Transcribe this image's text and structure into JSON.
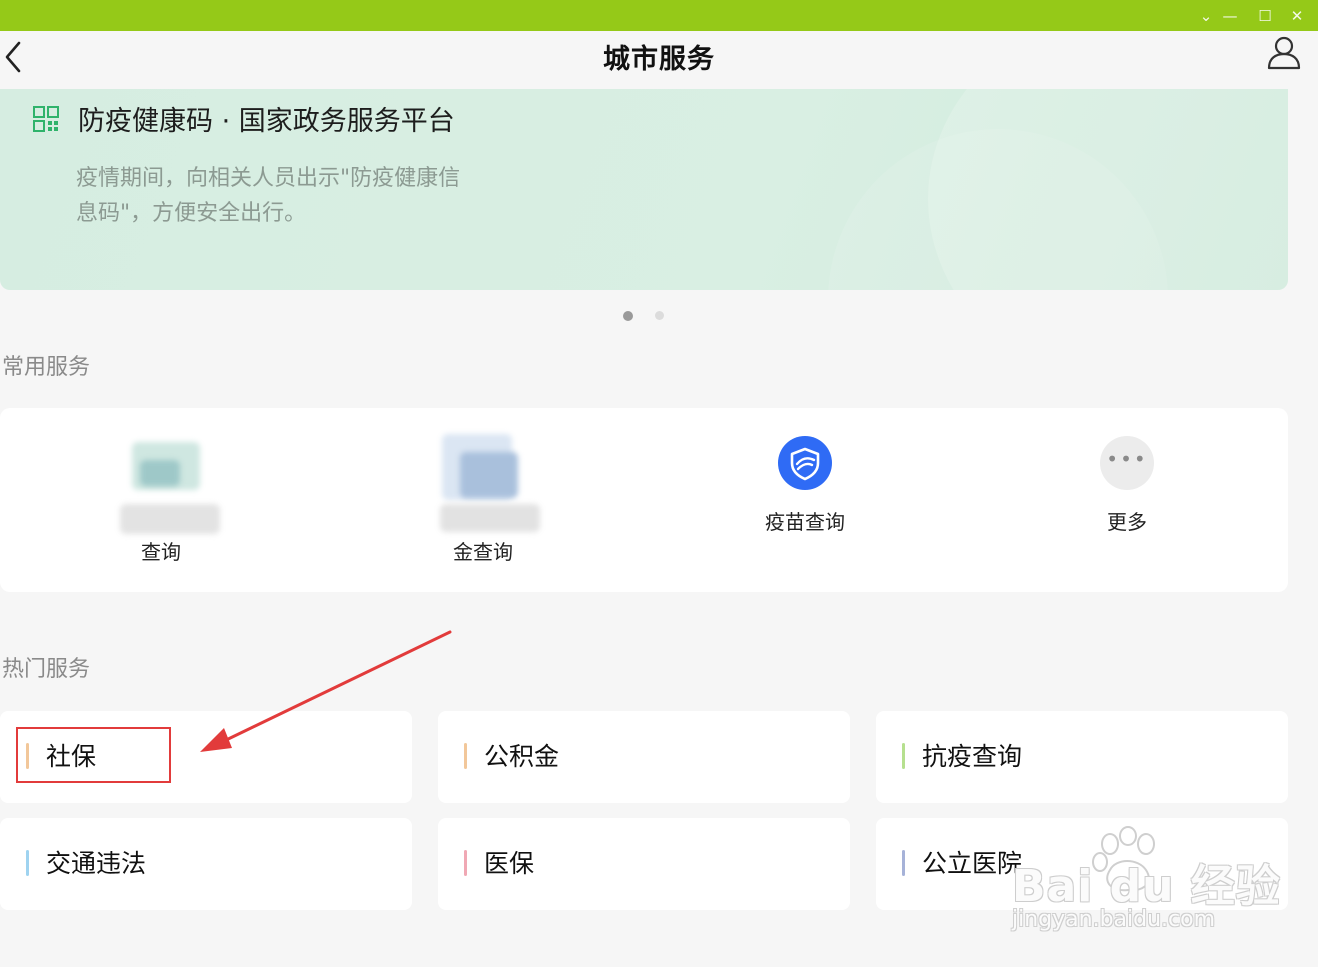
{
  "window": {
    "controls": {
      "chevron": "⌄",
      "minimize": "—",
      "maximize": "☐",
      "close": "✕"
    }
  },
  "header": {
    "title": "城市服务"
  },
  "banner": {
    "title": "防疫健康码 · 国家政务服务平台",
    "description": "疫情期间，向相关人员出示\"防疫健康信息码\"，方便安全出行。"
  },
  "carousel": {
    "current": 1,
    "total": 2
  },
  "common_services": {
    "title": "常用服务",
    "items": [
      {
        "label": "查询"
      },
      {
        "label": "金查询"
      },
      {
        "label": "疫苗查询"
      },
      {
        "label": "更多"
      }
    ]
  },
  "hot_services": {
    "title": "热门服务",
    "items": [
      {
        "label": "社保",
        "accent": "#f2c79a"
      },
      {
        "label": "公积金",
        "accent": "#f2c79a"
      },
      {
        "label": "抗疫查询",
        "accent": "#b6e08f"
      },
      {
        "label": "交通违法",
        "accent": "#9fd3f0"
      },
      {
        "label": "医保",
        "accent": "#f0a8b4"
      },
      {
        "label": "公立医院",
        "accent": "#a6b2d8"
      }
    ]
  },
  "watermark": {
    "brand": "Bai du 经验",
    "url": "jingyan.baidu.com"
  },
  "colors": {
    "titlebar": "#95c918",
    "highlight": "#e23b3b",
    "vaccine_icon": "#2f6bf5"
  }
}
